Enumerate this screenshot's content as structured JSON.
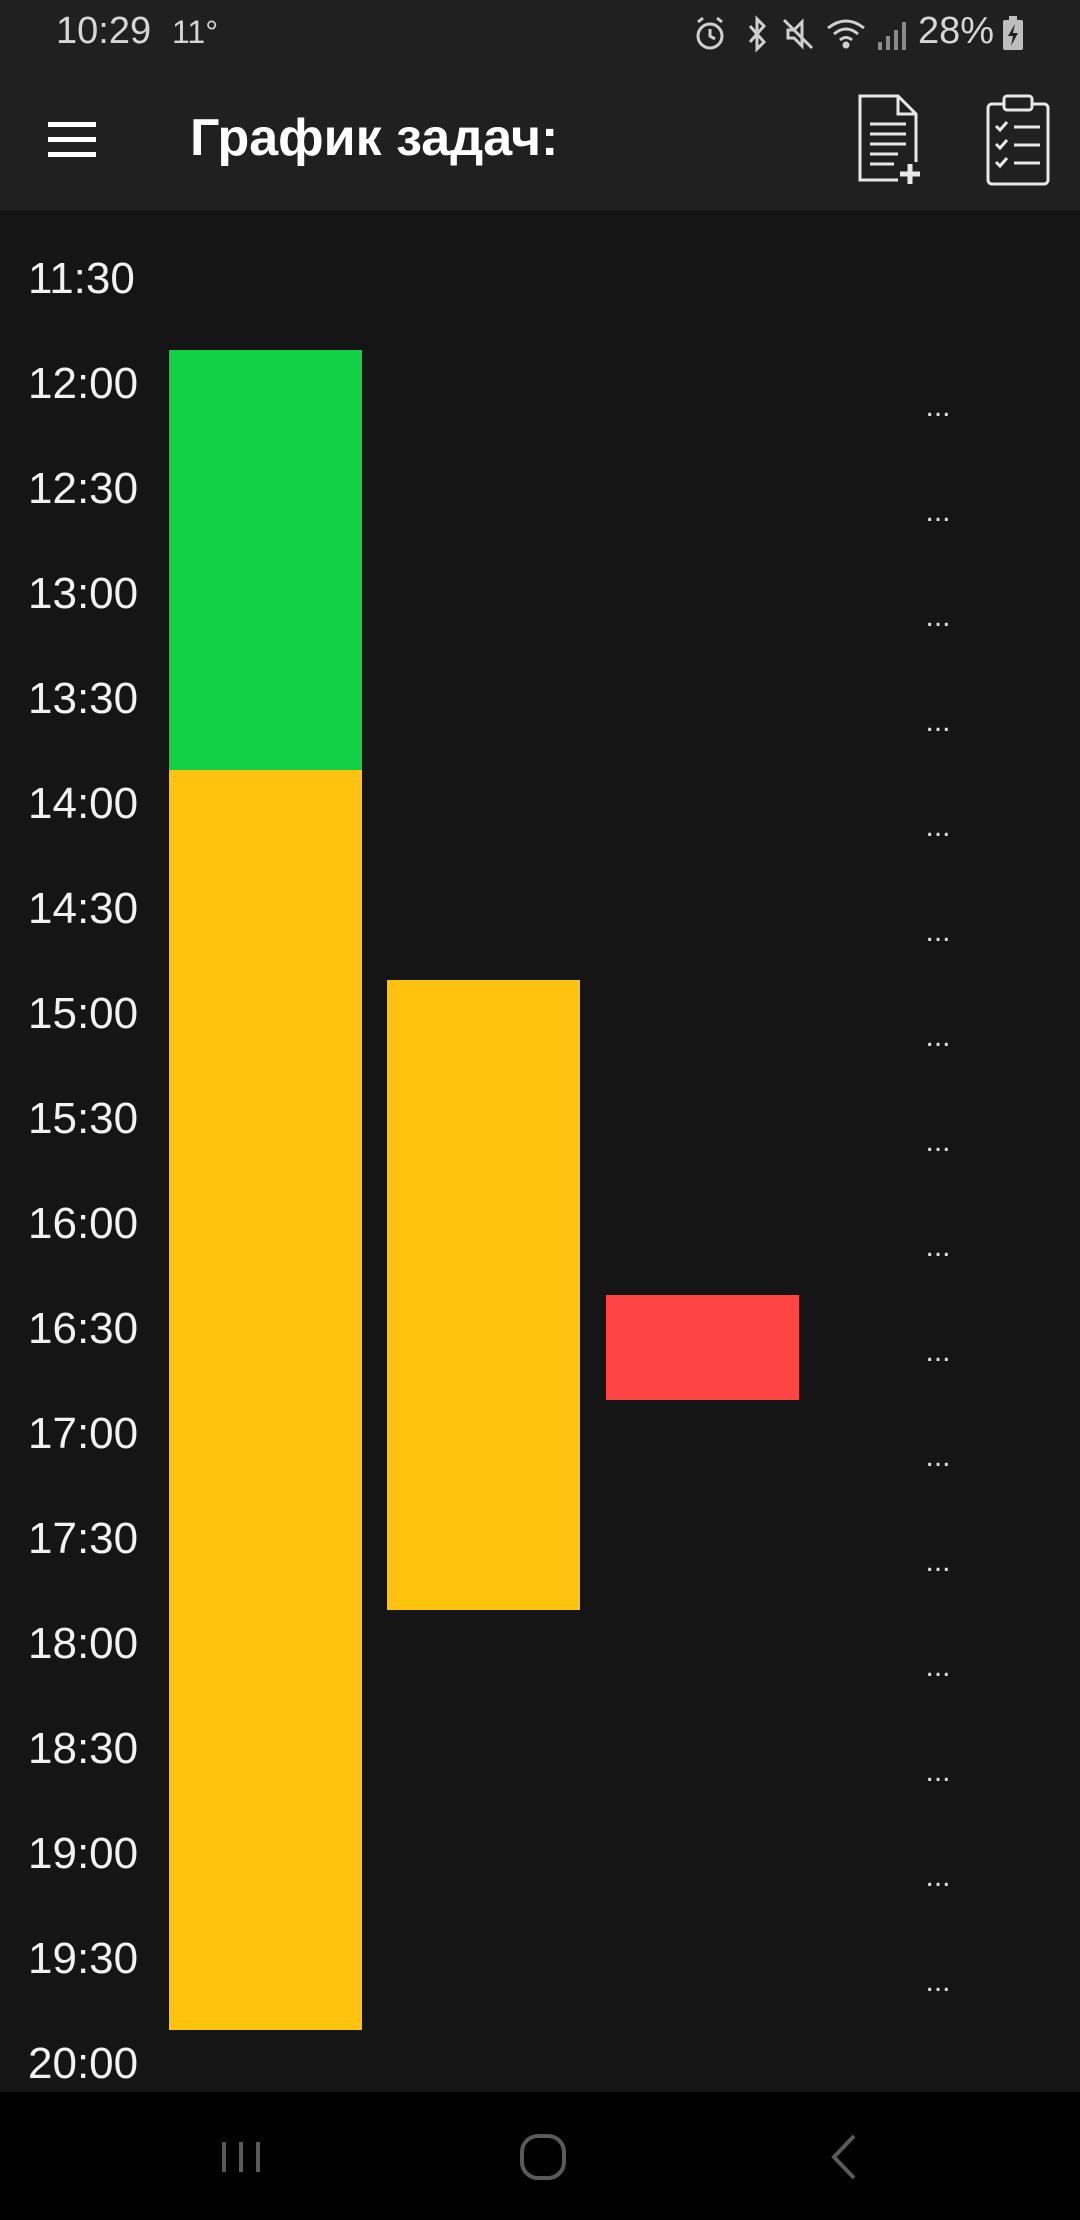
{
  "status_bar": {
    "time": "10:29",
    "temperature": "11°",
    "battery": "28%"
  },
  "app_bar": {
    "title": "График задач:"
  },
  "schedule": {
    "rows": [
      {
        "time": "11:30",
        "more": ""
      },
      {
        "time": "12:00",
        "more": "..."
      },
      {
        "time": "12:30",
        "more": "..."
      },
      {
        "time": "13:00",
        "more": "..."
      },
      {
        "time": "13:30",
        "more": "..."
      },
      {
        "time": "14:00",
        "more": "..."
      },
      {
        "time": "14:30",
        "more": "..."
      },
      {
        "time": "15:00",
        "more": "..."
      },
      {
        "time": "15:30",
        "more": "..."
      },
      {
        "time": "16:00",
        "more": "..."
      },
      {
        "time": "16:30",
        "more": "..."
      },
      {
        "time": "17:00",
        "more": "..."
      },
      {
        "time": "17:30",
        "more": "..."
      },
      {
        "time": "18:00",
        "more": "..."
      },
      {
        "time": "18:30",
        "more": "..."
      },
      {
        "time": "19:00",
        "more": "..."
      },
      {
        "time": "19:30",
        "more": "..."
      },
      {
        "time": "20:00",
        "more": ""
      }
    ],
    "tasks": [
      {
        "column": 1,
        "start": "12:00",
        "end": "14:00",
        "color": "#12d147"
      },
      {
        "column": 1,
        "start": "14:00",
        "end": "20:00",
        "color": "#ffc20e"
      },
      {
        "column": 2,
        "start": "15:00",
        "end": "18:00",
        "color": "#ffc20e"
      },
      {
        "column": 3,
        "start": "16:30",
        "end": "17:00",
        "color": "#ff4444"
      }
    ]
  },
  "colors": {
    "background": "#151516",
    "bar_background": "#202020",
    "nav_background": "#000000"
  }
}
